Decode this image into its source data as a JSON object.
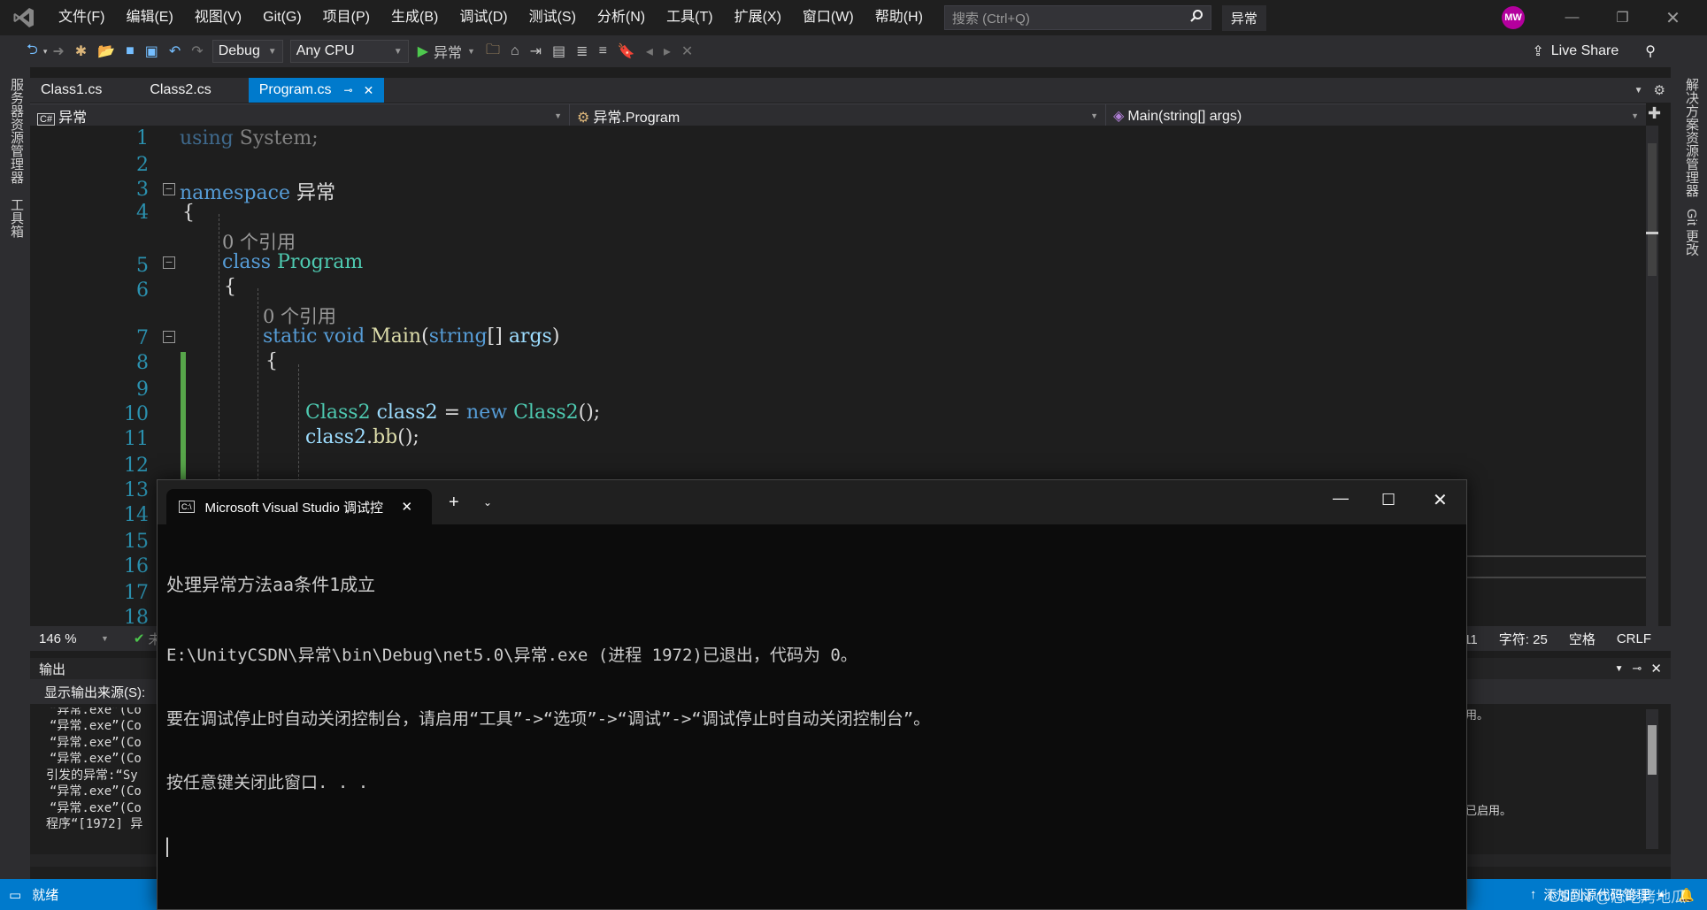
{
  "menu": {
    "items": [
      "文件(F)",
      "编辑(E)",
      "视图(V)",
      "Git(G)",
      "项目(P)",
      "生成(B)",
      "调试(D)",
      "测试(S)",
      "分析(N)",
      "工具(T)",
      "扩展(X)",
      "窗口(W)",
      "帮助(H)"
    ],
    "search_placeholder": "搜索 (Ctrl+Q)",
    "solution_title": "异常",
    "avatar_initials": "MW"
  },
  "toolbar": {
    "config": "Debug",
    "platform": "Any CPU",
    "start_label": "异常",
    "live_share": "Live Share"
  },
  "left_rail": {
    "server_explorer": "服务器资源管理器",
    "toolbox": "工具箱"
  },
  "right_rail": {
    "solution_explorer": "解决方案资源管理器",
    "git_changes": "Git 更改"
  },
  "tabs": [
    {
      "label": "Class1.cs"
    },
    {
      "label": "Class2.cs"
    },
    {
      "label": "Program.cs",
      "active": true
    }
  ],
  "nav": {
    "project": "异常",
    "type": "异常.Program",
    "member": "Main(string[] args)"
  },
  "code": {
    "line_numbers": [
      "1",
      "2",
      "3",
      "4",
      "5",
      "6",
      "7",
      "8",
      "9",
      "10",
      "11",
      "12",
      "13",
      "14",
      "15",
      "16",
      "17",
      "18"
    ],
    "l1_using": "using",
    "l1_ns": "System;",
    "l3_kw": "namespace",
    "l3_name": "异常",
    "brace_open": "{",
    "refs": "0 个引用",
    "l5_kw": "class",
    "l5_name": "Program",
    "l7_static": "static",
    "l7_void": "void",
    "l7_main": "Main",
    "l7_paren": "(",
    "l7_string": "string",
    "l7_arr": "[] ",
    "l7_args": "args",
    "l7_close": ")",
    "l10_type": "Class2",
    "l10_var": "class2",
    "l10_eq": " = ",
    "l10_new": "new",
    "l10_type2": "Class2",
    "l10_end": "();",
    "l11_var": "class2",
    "l11_dot": ".",
    "l11_fn": "bb",
    "l11_end": "();"
  },
  "status_line": {
    "zoom": "146 %",
    "issues_partial": "未",
    "line": "行: 11",
    "col": "字符: 25",
    "spaces": "空格",
    "eol": "CRLF"
  },
  "output": {
    "title": "输出",
    "source_label": "显示输出来源(S):",
    "lines": [
      "“异常.exe”(Co",
      "“异常.exe”(Co",
      "“异常.exe”(Co",
      "“异常.exe”(Co",
      "引发的异常:“Sy",
      "“异常.exe”(Co",
      "“异常.exe”(Co",
      "程序“[1972] 异"
    ],
    "right_fragments": [
      "用。",
      "已启用。"
    ]
  },
  "statusbar": {
    "ready": "就绪",
    "add_source": "添加到源代码管理",
    "watermark": "CSDN @您吃烤地瓜."
  },
  "console": {
    "tab_title": "Microsoft Visual Studio 调试控",
    "lines": [
      "处理异常方法aa条件1成立",
      "",
      "E:\\UnityCSDN\\异常\\bin\\Debug\\net5.0\\异常.exe (进程 1972)已退出，代码为 0。",
      "要在调试停止时自动关闭控制台，请启用“工具”->“选项”->“调试”->“调试停止时自动关闭控制台”。",
      "按任意键关闭此窗口. . ."
    ]
  },
  "colors": {
    "accent": "#007acc",
    "keyword": "#569cd6",
    "type": "#4ec9b0",
    "method": "#dcdcaa"
  }
}
